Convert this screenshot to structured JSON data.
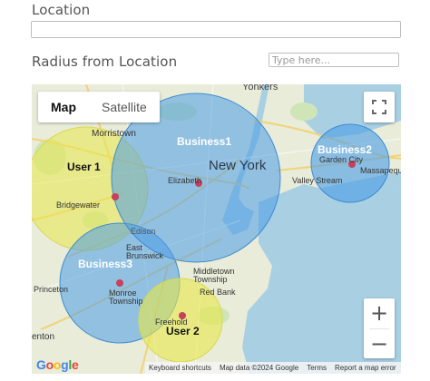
{
  "form": {
    "location_label": "Location",
    "location_value": "",
    "radius_label": "Radius from Location",
    "radius_placeholder": "Type here..."
  },
  "map": {
    "map_type_buttons": [
      "Map",
      "Satellite"
    ],
    "selected_map_type": "Map",
    "zoom_in_label": "+",
    "zoom_out_label": "−",
    "place_labels": {
      "yonkers": "Yonkers",
      "morristown": "Morristown",
      "new_york": "New York",
      "elizabeth": "Elizabeth",
      "garden_city": "Garden City",
      "massapequa": "Massapequa",
      "valley_stream": "Valley Stream",
      "bridgewater": "Bridgewater",
      "edison": "Edison",
      "east_brunswick": "East\nBrunswick",
      "princeton": "Princeton",
      "monroe_township": "Monroe\nTownship",
      "middletown_township": "Middletown\nTownship",
      "red_bank": "Red Bank",
      "freehold": "Freehold",
      "trenton_partial": "enton"
    },
    "circles": [
      {
        "label": "Business1",
        "color": "#4a9de6"
      },
      {
        "label": "Business2",
        "color": "#4a9de6"
      },
      {
        "label": "Business3",
        "color": "#4a9de6"
      },
      {
        "label": "User 1",
        "color": "#e8e84a"
      },
      {
        "label": "User 2",
        "color": "#e8e84a"
      }
    ],
    "attribution": {
      "keyboard": "Keyboard shortcuts",
      "map_data": "Map data ©2024 Google",
      "terms": "Terms",
      "report": "Report a map error"
    },
    "google_logo": "Google"
  }
}
